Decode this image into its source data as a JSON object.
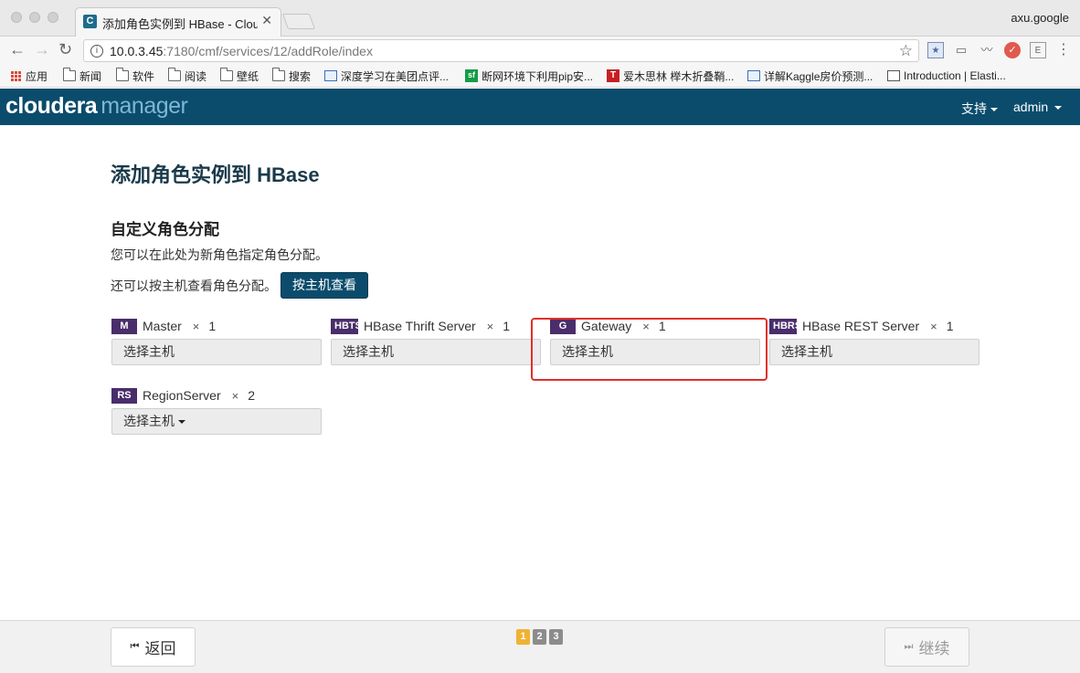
{
  "browser": {
    "tab_title": "添加角色实例到 HBase - Cloudera",
    "tab_favicon": "C",
    "tab_close": "✕",
    "profile": "axu.google",
    "url_host": "10.0.3.45",
    "url_rest": ":7180/cmf/services/12/addRole/index",
    "info_glyph": "i",
    "star_glyph": "☆"
  },
  "bookmarks": [
    {
      "label": "应用",
      "icon": "apps-grid-icon"
    },
    {
      "label": "新闻",
      "icon": "folder-icon"
    },
    {
      "label": "软件",
      "icon": "folder-icon"
    },
    {
      "label": "阅读",
      "icon": "folder-icon"
    },
    {
      "label": "壁纸",
      "icon": "folder-icon"
    },
    {
      "label": "搜索",
      "icon": "folder-icon"
    },
    {
      "label": "深度学习在美团点评...",
      "icon": "chart-icon"
    },
    {
      "label": "断网环境下利用pip安...",
      "icon": "sf-icon"
    },
    {
      "label": "爱木思林 榉木折叠鞘...",
      "icon": "t-icon"
    },
    {
      "label": "详解Kaggle房价预测...",
      "icon": "chart-icon"
    },
    {
      "label": "Introduction | Elasti...",
      "icon": "book-icon"
    }
  ],
  "header": {
    "logo_part1": "cloudera",
    "logo_part2": "manager",
    "support": "支持",
    "user": "admin"
  },
  "page": {
    "title": "添加角色实例到 HBase",
    "section_title": "自定义角色分配",
    "desc1": "您可以在此处为新角色指定角色分配。",
    "desc2": "还可以按主机查看角色分配。",
    "view_by_host_button": "按主机查看"
  },
  "roles": [
    {
      "badge": "M",
      "name": "Master",
      "times": "×",
      "count": "1",
      "select": "选择主机"
    },
    {
      "badge": "HBTS",
      "name": "HBase Thrift Server",
      "times": "×",
      "count": "1",
      "select": "选择主机"
    },
    {
      "badge": "G",
      "name": "Gateway",
      "times": "×",
      "count": "1",
      "select": "选择主机"
    },
    {
      "badge": "HBRS",
      "name": "HBase REST Server",
      "times": "×",
      "count": "1",
      "select": "选择主机"
    },
    {
      "badge": "RS",
      "name": "RegionServer",
      "times": "×",
      "count": "2",
      "select": "选择主机"
    }
  ],
  "footer": {
    "back": "返回",
    "continue": "继续",
    "steps": [
      "1",
      "2",
      "3"
    ],
    "current_step": 1,
    "step_active_color": "#f0b232",
    "step_inactive_color": "#8c8c8c"
  },
  "colors": {
    "brand": "#0b4c6c",
    "badge": "#4a2d6b",
    "highlight": "#e0302a"
  }
}
